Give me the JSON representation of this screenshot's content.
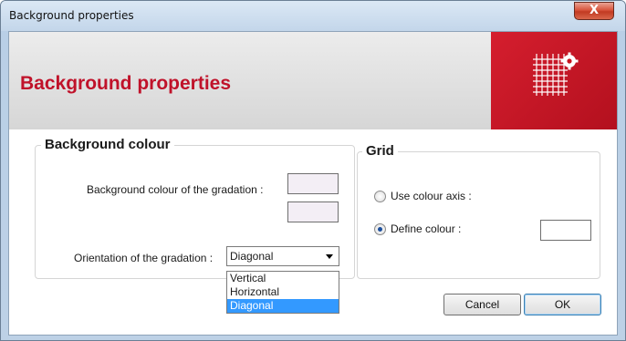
{
  "window": {
    "title": "Background properties",
    "close_label": "X"
  },
  "header": {
    "title": "Background properties",
    "logo_icon": "grid-gear-icon"
  },
  "colors": {
    "accent": "#c0122a",
    "logo_bg": "#d51e2e",
    "selection": "#3399ff"
  },
  "background_colour": {
    "legend": "Background colour",
    "gradation_label": "Background colour of the gradation :",
    "orientation_label": "Orientation of the gradation :",
    "orientation_value": "Diagonal",
    "orientation_options": [
      "Vertical",
      "Horizontal",
      "Diagonal"
    ],
    "swatch_color_1": "#f3eef5",
    "swatch_color_2": "#f3eef5"
  },
  "grid": {
    "legend": "Grid",
    "use_colour_axis_label": "Use colour axis :",
    "define_colour_label": "Define colour :",
    "selected": "define_colour",
    "define_colour_swatch": "#ffffff"
  },
  "buttons": {
    "cancel": "Cancel",
    "ok": "OK"
  }
}
